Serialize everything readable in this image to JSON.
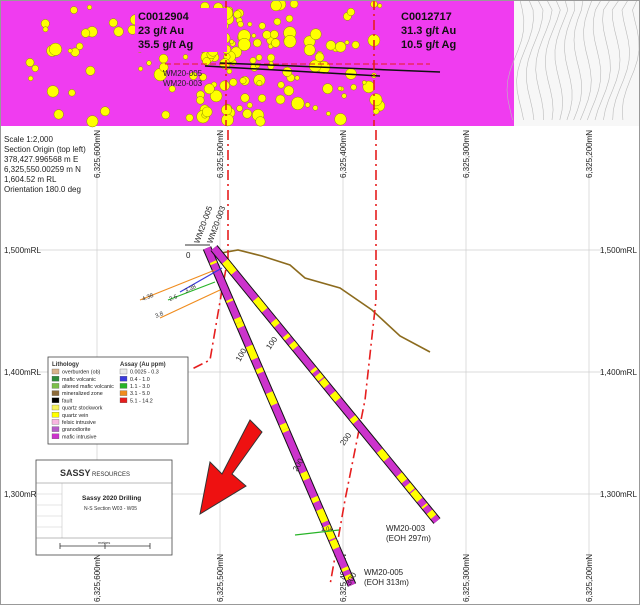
{
  "plan_callouts": [
    {
      "hole": "C0012904",
      "au": "23 g/t Au",
      "ag": "35.5 g/t Ag"
    },
    {
      "hole": "C0012717",
      "au": "31.3 g/t Au",
      "ag": "10.5 g/t Ag"
    }
  ],
  "plan_hole_labels": [
    "WM20-005",
    "WM20-003"
  ],
  "section_info": {
    "scale": "Scale 1:2,000",
    "origin_title": "Section Origin (top left)",
    "easting": "378,427.996568 m E",
    "northing": "6,325,550.00259 m N",
    "rl": "1,604.52 m RL",
    "orientation": "Orientation 180.0 deg"
  },
  "northing_ticks": [
    "6,325,600mN",
    "6,325,500mN",
    "6,325,400mN",
    "6,325,300mN",
    "6,325,200mN"
  ],
  "rl_ticks": [
    "1,500mRL",
    "1,400mRL",
    "1,300mRL"
  ],
  "collar_labels": [
    "WM20-005",
    "WM20-003"
  ],
  "depth_labels": [
    "0",
    "100",
    "100",
    "200",
    "200",
    "300"
  ],
  "assay_labels": [
    "4.38",
    "2.6",
    "3.38",
    "3.8",
    "1.04"
  ],
  "eoh_labels": [
    {
      "hole": "WM20-003",
      "eoh": "(EOH 297m)"
    },
    {
      "hole": "WM20-005",
      "eoh": "(EOH 313m)"
    }
  ],
  "legend": {
    "lithology_title": "Lithology",
    "lithology": [
      {
        "label": "overburden (ob)",
        "color": "#d9b38c"
      },
      {
        "label": "mafic volcanic",
        "color": "#2e8b3a"
      },
      {
        "label": "altered mafic volcanic",
        "color": "#7cbf4a"
      },
      {
        "label": "mineralized zone",
        "color": "#8c6b3a"
      },
      {
        "label": "fault",
        "color": "#000000"
      },
      {
        "label": "quartz stockwork",
        "color": "#f6f25a"
      },
      {
        "label": "quartz vein",
        "color": "#ffff00"
      },
      {
        "label": "felsic intrusive",
        "color": "#f7b6e0"
      },
      {
        "label": "granodiorite",
        "color": "#b45cc8"
      },
      {
        "label": "mafic intrusive",
        "color": "#cc33cc"
      }
    ],
    "assay_title": "Assay (Au ppm)",
    "assay": [
      {
        "label": "0.0025 - 0.3",
        "color": "#e8e8e8"
      },
      {
        "label": "0.4 - 1.0",
        "color": "#3a3adc"
      },
      {
        "label": "1.1 - 3.0",
        "color": "#28b428"
      },
      {
        "label": "3.1 - 5.0",
        "color": "#f08c1e"
      },
      {
        "label": "5.1 - 14.2",
        "color": "#e61e1e"
      }
    ]
  },
  "title_block": {
    "company": "SASSY",
    "company_suffix": "RESOURCES",
    "project": "Sassy 2020 Drilling",
    "section": "N-S Section W03 - W05",
    "scale_label": "metres"
  },
  "colors": {
    "plan_magenta": "#f03cf0",
    "drill_trace": "#cc33cc",
    "section_line": "#e61e1e",
    "topo": "#8c6b1e",
    "arrow": "#ee1111"
  }
}
